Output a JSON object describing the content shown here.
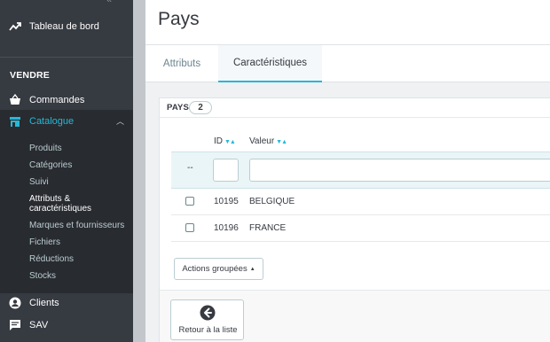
{
  "sidebar": {
    "dashboard_label": "Tableau de bord",
    "section_vendre": "VENDRE",
    "commandes_label": "Commandes",
    "catalogue_label": "Catalogue",
    "catalogue_items": [
      "Produits",
      "Catégories",
      "Suivi",
      "Attributs &",
      "caractéristiques",
      "Marques et fournisseurs",
      "Fichiers",
      "Réductions",
      "Stocks"
    ],
    "clients_label": "Clients",
    "sav_label": "SAV"
  },
  "header": {
    "title": "Pays"
  },
  "tabs": [
    {
      "label": "Attributs"
    },
    {
      "label": "Caractéristiques"
    }
  ],
  "panel": {
    "title": "PAYS",
    "count": "2",
    "columns": {
      "id": "ID",
      "valeur": "Valeur"
    },
    "filter_placeholder": "--",
    "rows": [
      {
        "id": "10195",
        "valeur": "BELGIQUE"
      },
      {
        "id": "10196",
        "valeur": "FRANCE"
      }
    ],
    "bulk_actions_label": "Actions groupées",
    "back_label": "Retour à la liste"
  },
  "colors": {
    "accent": "#25b9d7",
    "sidebar_bg": "#363a41",
    "sidebar_active_bg": "#282b30"
  },
  "icons": {
    "dashboard": "trending-up-icon",
    "commandes": "shopping-basket-icon",
    "catalogue": "store-icon",
    "clients": "account-circle-icon",
    "sav": "chat-icon",
    "back": "arrow-left-circle-icon"
  }
}
